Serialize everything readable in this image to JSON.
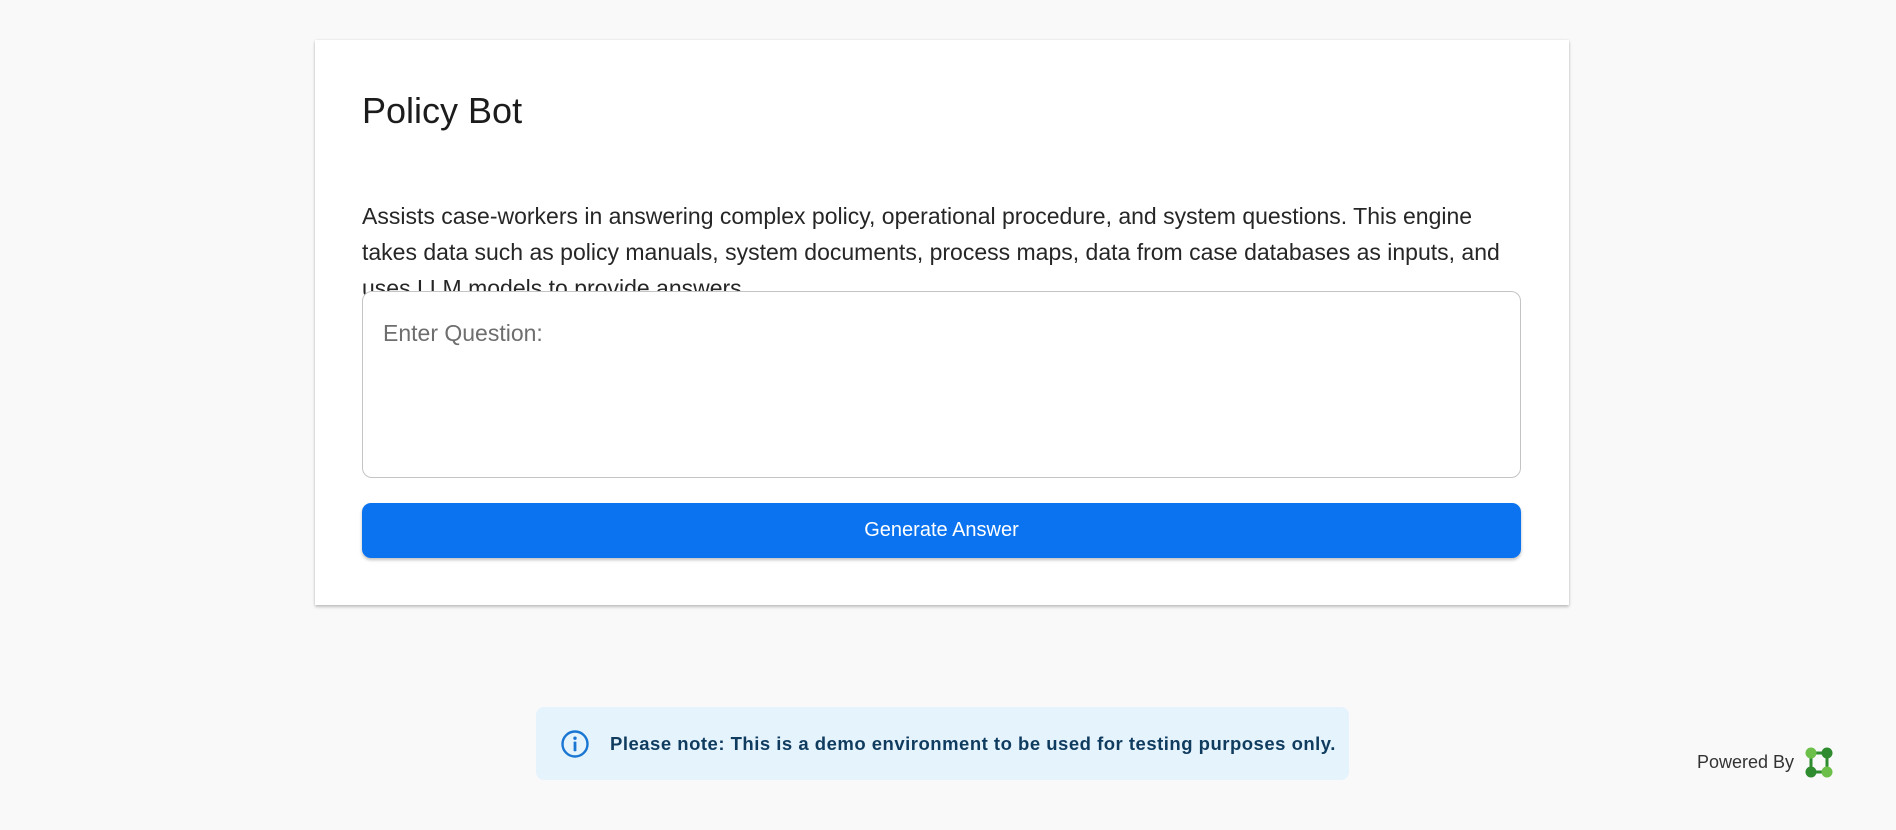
{
  "header": {
    "title": "Policy Bot"
  },
  "main": {
    "description": "Assists case-workers in answering complex policy, operational procedure, and system questions. This engine takes data such as policy manuals, system documents, process maps, data from case databases as inputs, and uses LLM models to provide answers.",
    "question": {
      "value": "",
      "placeholder": "Enter Question:"
    },
    "generate_button_label": "Generate Answer"
  },
  "notice": {
    "icon": "info-icon",
    "text": "Please note: This is a demo environment to be used for testing purposes only."
  },
  "footer": {
    "powered_by_label": "Powered By",
    "logo_icon": "network-nodes-icon"
  },
  "colors": {
    "page_background": "#f9f9f9",
    "card_background": "#ffffff",
    "primary_button": "#0b73ef",
    "notice_background": "#e5f3fd",
    "notice_text": "#0f3b5f",
    "info_icon": "#1976d2",
    "logo_green_light": "#6cc04a",
    "logo_green_dark": "#2e8b2e"
  }
}
